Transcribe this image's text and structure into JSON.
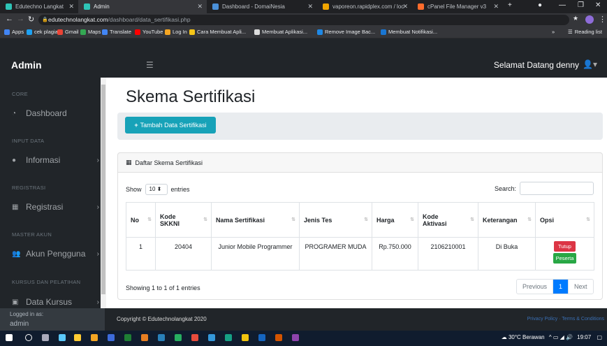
{
  "browser": {
    "tabs": [
      {
        "label": "Edutechno Langkat",
        "color": "#2ec4b6"
      },
      {
        "label": "Admin",
        "color": "#2ec4b6"
      },
      {
        "label": "Dashboard - DomaiNesia",
        "color": "#4a90d9"
      },
      {
        "label": "vaporeon.rapidplex.com / loc",
        "color": "#f0a500"
      },
      {
        "label": "cPanel File Manager v3",
        "color": "#ff6c2c"
      }
    ],
    "new_tab": "+",
    "url_host": "edutechnolangkat.com",
    "url_path": "/dashboard/data_sertifikasi.php",
    "bookmarks": [
      {
        "label": "Apps",
        "color": "#4285f4"
      },
      {
        "label": "cek plagiat",
        "color": "#1da1f2"
      },
      {
        "label": "Gmail",
        "color": "#ea4335"
      },
      {
        "label": "Maps",
        "color": "#34a853"
      },
      {
        "label": "Translate",
        "color": "#4285f4"
      },
      {
        "label": "YouTube",
        "color": "#ff0000"
      },
      {
        "label": "Log In",
        "color": "#f5a623"
      },
      {
        "label": "Cara Membuat Apli...",
        "color": "#f5c518"
      },
      {
        "label": "Membuat Aplikasi...",
        "color": "#dddddd"
      },
      {
        "label": "Remove Image Bac...",
        "color": "#1e88e5"
      },
      {
        "label": "Membuat Notifikasi...",
        "color": "#1976d2"
      }
    ],
    "bookmarks_more": "»",
    "reading_list": "Reading list"
  },
  "header": {
    "brand": "Admin",
    "greeting": "Selamat Datang denny"
  },
  "sidebar": {
    "sections": [
      {
        "heading": "CORE",
        "items": [
          {
            "label": "Dashboard",
            "icon": "tachometer-icon",
            "chevron": false
          }
        ]
      },
      {
        "heading": "INPUT DATA",
        "items": [
          {
            "label": "Informasi",
            "icon": "info-icon",
            "chevron": true
          }
        ]
      },
      {
        "heading": "REGISTRASI",
        "items": [
          {
            "label": "Registrasi",
            "icon": "table-icon",
            "chevron": true
          }
        ]
      },
      {
        "heading": "MASTER AKUN",
        "items": [
          {
            "label": "Akun Pengguna",
            "icon": "users-icon",
            "chevron": true
          }
        ]
      },
      {
        "heading": "KURSUS DAN PELATIHAN",
        "items": [
          {
            "label": "Data Kursus",
            "icon": "book-icon",
            "chevron": true
          }
        ]
      }
    ],
    "footer_line1": "Logged in as:",
    "footer_line2": "admin"
  },
  "main": {
    "title": "Skema Sertifikasi",
    "add_button": "Tambah Data Sertifikasi",
    "card_title": "Daftar Skema Sertifikasi",
    "show_label": "Show",
    "show_value": "10",
    "entries_label": "entries",
    "search_label": "Search:",
    "columns": [
      "No",
      "Kode SKKNI",
      "Nama Sertifikasi",
      "Jenis Tes",
      "Harga",
      "Kode Aktivasi",
      "Keterangan",
      "Opsi"
    ],
    "rows": [
      {
        "no": "1",
        "kode_skkni": "20404",
        "nama": "Junior Mobile Programmer",
        "jenis": "PROGRAMER MUDA",
        "harga": "Rp.750.000",
        "kode_aktivasi": "2106210001",
        "keterangan": "Di Buka",
        "btn_tutup": "Tutup",
        "btn_peserta": "Peserta"
      }
    ],
    "showing": "Showing 1 to 1 of 1 entries",
    "pager": {
      "previous": "Previous",
      "page": "1",
      "next": "Next"
    }
  },
  "footer": {
    "copyright": "Copyright © Edutechnolangkat 2020",
    "links": "Privacy Policy · Terms & Conditions"
  },
  "taskbar": {
    "weather": "30°C Berawan",
    "time": "19:07"
  }
}
